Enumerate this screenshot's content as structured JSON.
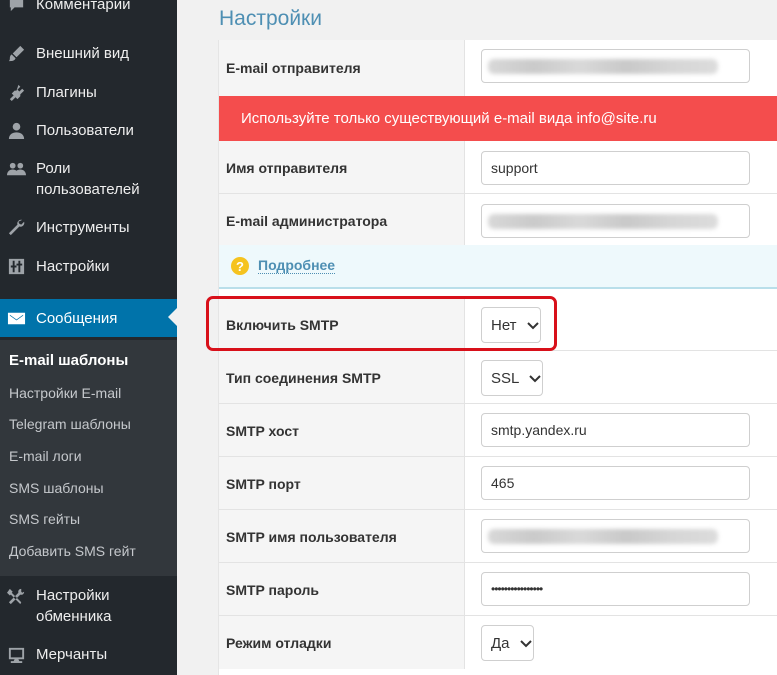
{
  "sidebar": {
    "items": [
      {
        "label": "Комментарии",
        "icon": "comment-icon"
      },
      {
        "label": "Внешний вид",
        "icon": "brush-icon"
      },
      {
        "label": "Плагины",
        "icon": "plugin-icon"
      },
      {
        "label": "Пользователи",
        "icon": "user-icon"
      },
      {
        "label": "Роли пользователей",
        "line1": "Роли",
        "line2": "пользователей",
        "icon": "users-group-icon"
      },
      {
        "label": "Инструменты",
        "icon": "wrench-icon"
      },
      {
        "label": "Настройки",
        "icon": "settings-sliders-icon"
      },
      {
        "label": "Сообщения",
        "icon": "envelope-icon"
      }
    ],
    "submenu": [
      "E-mail шаблоны",
      "Настройки E-mail",
      "Telegram шаблоны",
      "E-mail логи",
      "SMS шаблоны",
      "SMS гейты",
      "Добавить SMS гейт"
    ],
    "bottom": [
      {
        "line1": "Настройки",
        "line2": "обменника",
        "icon": "tools-icon"
      },
      {
        "label": "Мерчанты",
        "icon": "merchant-icon"
      }
    ]
  },
  "main": {
    "title": "Настройки",
    "alert": "Используйте только существующий e-mail вида info@site.ru",
    "info_link": "Подробнее",
    "info_icon": "?",
    "fields": {
      "sender_email": {
        "label": "E-mail отправителя",
        "value": ""
      },
      "sender_name": {
        "label": "Имя отправителя",
        "value": "support"
      },
      "admin_email": {
        "label": "E-mail администратора",
        "value": ""
      },
      "enable_smtp": {
        "label": "Включить SMTP",
        "value": "Нет"
      },
      "smtp_type": {
        "label": "Тип соединения SMTP",
        "value": "SSL"
      },
      "smtp_host": {
        "label": "SMTP хост",
        "value": "smtp.yandex.ru"
      },
      "smtp_port": {
        "label": "SMTP порт",
        "value": "465"
      },
      "smtp_user": {
        "label": "SMTP имя пользователя",
        "value": ""
      },
      "smtp_password": {
        "label": "SMTP пароль",
        "value": "••••••••••••••••"
      },
      "debug_mode": {
        "label": "Режим отладки",
        "value": "Да"
      }
    }
  },
  "colors": {
    "sidebar_bg": "#23282d",
    "submenu_bg": "#32373c",
    "active": "#0073aa",
    "alert": "#f44d4d",
    "highlight": "#d8101a",
    "title": "#4e8fb3"
  }
}
